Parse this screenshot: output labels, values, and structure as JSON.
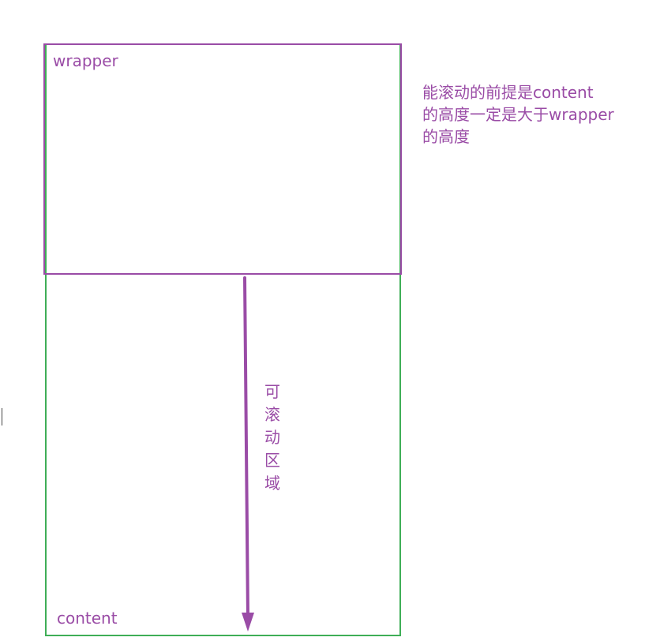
{
  "diagram": {
    "wrapper_label": "wrapper",
    "content_label": "content",
    "note_lines": [
      "能滚动的前提是content",
      "的高度一定是大于wrapper",
      "的高度"
    ],
    "scroll_area_chars": [
      "可",
      "滚",
      "动",
      "区",
      "域"
    ]
  },
  "colors": {
    "purple": "#9a4ca6",
    "green": "#3fae57"
  }
}
